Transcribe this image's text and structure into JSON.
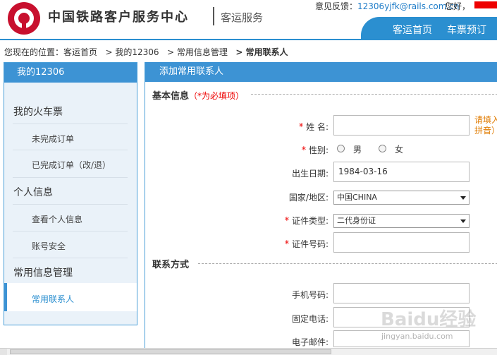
{
  "header": {
    "site_title": "中国铁路客户服务中心",
    "site_sub": "客运服务",
    "feedback_label": "意见反馈：",
    "feedback_email": "12306yjfk@rails.com.cn",
    "greeting": "您好，",
    "nav": [
      "客运首页",
      "车票预订"
    ]
  },
  "breadcrumb": {
    "prefix": "您现在的位置：",
    "items": [
      "客运首页",
      "> 我的12306",
      "> 常用信息管理",
      "> 常用联系人"
    ]
  },
  "sidebar": {
    "title": "我的12306",
    "groups": [
      {
        "label": "我的火车票",
        "items": [
          "未完成订单",
          "已完成订单（改/退）"
        ]
      },
      {
        "label": "个人信息",
        "items": [
          "查看个人信息",
          "账号安全"
        ]
      },
      {
        "label": "常用信息管理",
        "items": [
          "常用联系人"
        ]
      }
    ],
    "active_item": "常用联系人"
  },
  "main": {
    "title": "添加常用联系人",
    "basic_section": "基本信息",
    "required_note": "（*为必填项）",
    "contact_section": "联系方式",
    "fields": {
      "name_label": "姓  名:",
      "name_value": "",
      "name_hint": "请填入拼音）",
      "gender_label": "性别:",
      "gender_options": [
        "男",
        "女"
      ],
      "birth_label": "出生日期:",
      "birth_value": "1984-03-16",
      "country_label": "国家/地区:",
      "country_value": "中国CHINA",
      "id_type_label": "证件类型:",
      "id_type_value": "二代身份证",
      "id_no_label": "证件号码:",
      "id_no_value": "",
      "mobile_label": "手机号码:",
      "mobile_value": "",
      "phone_label": "固定电话:",
      "phone_value": "",
      "email_label": "电子邮件:",
      "email_value": ""
    }
  },
  "watermark": {
    "text": "Baidu经验",
    "sub": "jingyan.baidu.com"
  }
}
